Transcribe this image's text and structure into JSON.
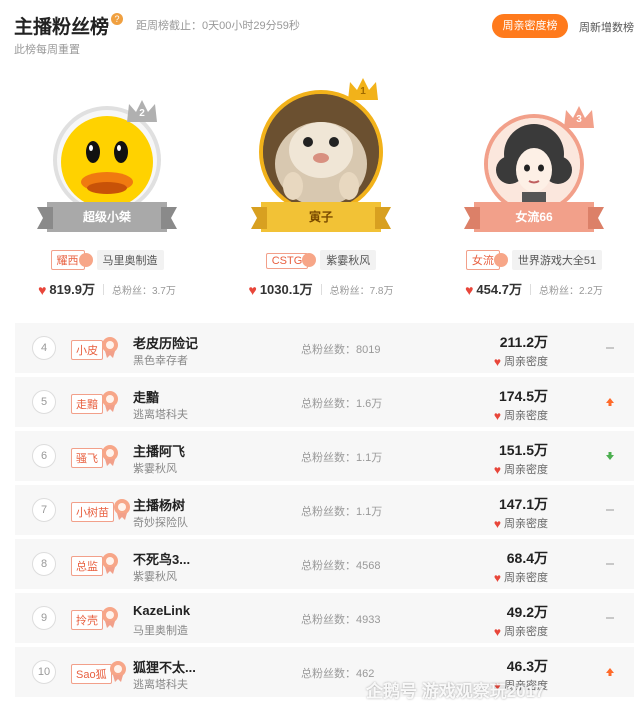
{
  "header": {
    "title": "主播粉丝榜",
    "countdown": "距周榜截止：0天00小时29分59秒",
    "subtitle": "此榜每周重置",
    "tabs": [
      {
        "label": "周亲密度榜",
        "active": true
      },
      {
        "label": "周新增数榜",
        "active": false
      }
    ]
  },
  "top3": [
    {
      "rank": "2",
      "name": "超级小桀",
      "fan_tag": "耀西",
      "guild": "马里奥制造",
      "intimacy": "819.9万",
      "fans": "总粉丝：3.7万",
      "crown_color": "#b0b0b0"
    },
    {
      "rank": "1",
      "name": "寅子",
      "fan_tag": "CSTG",
      "guild": "紫霎秋风",
      "intimacy": "1030.1万",
      "fans": "总粉丝：7.8万",
      "crown_color": "#f2b21a"
    },
    {
      "rank": "3",
      "name": "女流66",
      "fan_tag": "女流",
      "guild": "世界游戏大全51",
      "intimacy": "454.7万",
      "fans": "总粉丝：2.2万",
      "crown_color": "#f2a08a"
    }
  ],
  "rows": [
    {
      "rank": "4",
      "fan_tag": "小皮",
      "name": "老皮历险记",
      "guild": "黑色幸存者",
      "fans": "总粉丝数：8019",
      "intimacy": "211.2万",
      "label": "周亲密度",
      "trend": "same"
    },
    {
      "rank": "5",
      "fan_tag": "走黯",
      "name": "走黯",
      "guild": "逃离塔科夫",
      "fans": "总粉丝数：1.6万",
      "intimacy": "174.5万",
      "label": "周亲密度",
      "trend": "up"
    },
    {
      "rank": "6",
      "fan_tag": "骚飞",
      "name": "主播阿飞",
      "guild": "紫霎秋风",
      "fans": "总粉丝数：1.1万",
      "intimacy": "151.5万",
      "label": "周亲密度",
      "trend": "down"
    },
    {
      "rank": "7",
      "fan_tag": "小树苗",
      "name": "主播杨树",
      "guild": "奇妙探险队",
      "fans": "总粉丝数：1.1万",
      "intimacy": "147.1万",
      "label": "周亲密度",
      "trend": "same"
    },
    {
      "rank": "8",
      "fan_tag": "总监",
      "name": "不死鸟3...",
      "guild": "紫霎秋风",
      "fans": "总粉丝数：4568",
      "intimacy": "68.4万",
      "label": "周亲密度",
      "trend": "same"
    },
    {
      "rank": "9",
      "fan_tag": "拎壳",
      "name": "KazeLink",
      "guild": "马里奥制造",
      "fans": "总粉丝数：4933",
      "intimacy": "49.2万",
      "label": "周亲密度",
      "trend": "same"
    },
    {
      "rank": "10",
      "fan_tag": "Sao狐",
      "name": "狐狸不太...",
      "guild": "逃离塔科夫",
      "fans": "总粉丝数：462",
      "intimacy": "46.3万",
      "label": "周亲密度",
      "trend": "up"
    }
  ],
  "watermark": "企鹅号 游戏观察玩2017",
  "colors": {
    "accent": "#ff7a1c",
    "heart": "#e8463a",
    "up": "#ff6a2a",
    "down": "#4caf50",
    "same": "#c8c8c8"
  }
}
